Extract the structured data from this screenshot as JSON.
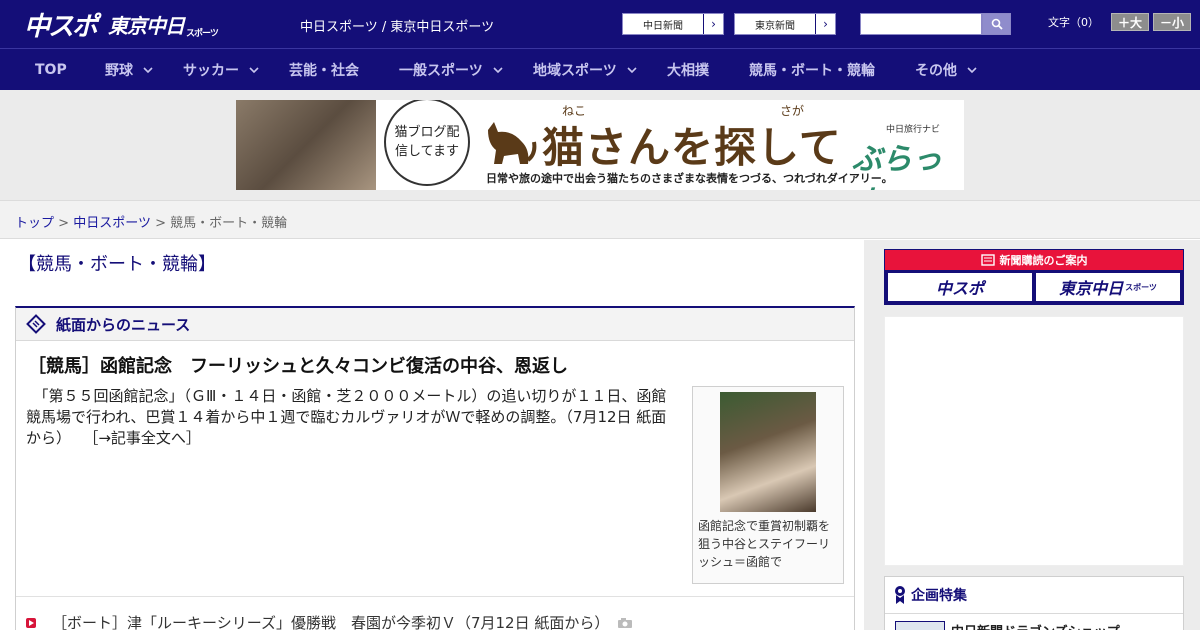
{
  "header": {
    "logo_main": "中スポ",
    "logo_tokyo": "東京中日",
    "logo_tokyo_small": "スポーツ",
    "site_title": "中日スポーツ / 東京中日スポーツ",
    "ext_links": [
      {
        "label": "中日新聞",
        "arrow": "›"
      },
      {
        "label": "東京新聞",
        "arrow": "›"
      }
    ],
    "search": {
      "value": "",
      "placeholder": ""
    },
    "font_size": {
      "label": "文字（0）",
      "bigger": "＋大",
      "smaller": "－小"
    }
  },
  "nav": [
    {
      "label": "TOP",
      "dropdown": false
    },
    {
      "label": "野球",
      "dropdown": true
    },
    {
      "label": "サッカー",
      "dropdown": true
    },
    {
      "label": "芸能・社会",
      "dropdown": false
    },
    {
      "label": "一般スポーツ",
      "dropdown": true
    },
    {
      "label": "地域スポーツ",
      "dropdown": true
    },
    {
      "label": "大相撲",
      "dropdown": false
    },
    {
      "label": "競馬・ボート・競輪",
      "dropdown": false
    },
    {
      "label": "その他",
      "dropdown": true
    }
  ],
  "banner": {
    "bubble": "猫ブログ配信してます",
    "title": "猫さんを探して",
    "ruby1": "ねこ",
    "ruby2": "さが",
    "subtitle": "日常や旅の途中で出会う猫たちのさまざまな表情をつづる、つれづれダイアリー。",
    "brand_small": "中日旅行ナビ",
    "brand": "ぶらっ人"
  },
  "breadcrumb": {
    "items": [
      "トップ",
      "中日スポーツ"
    ],
    "separator": ">",
    "current": "競馬・ボート・競輪"
  },
  "page": {
    "title": "【競馬・ボート・競輪】"
  },
  "news": {
    "heading": "紙面からのニュース",
    "article": {
      "title": "［競馬］函館記念　フーリッシュと久々コンビ復活の中谷、恩返し",
      "body": "　「第５５回函館記念」（ＧⅢ・１４日・函館・芝２０００メートル）の追い切りが１１日、函館競馬場で行われ、巴賞１４着から中１週で臨むカルヴァリオがＷで軽めの調整。（7月12日 紙面から）",
      "more": "［→記事全文へ］",
      "photo_caption": "函館記念で重賞初制覇を狙う中谷とステイフーリッシュ＝函館で"
    },
    "list": [
      {
        "text": "［ボート］津「ルーキーシリーズ」優勝戦　春園が今季初Ｖ（7月12日 紙面から）"
      }
    ]
  },
  "sidebar": {
    "subscribe_head": "新聞購読のご案内",
    "subscribe_logos": [
      "中スポ",
      "東京中日"
    ],
    "subscribe_logo_small": "スポーツ",
    "feature_heading": "企画特集",
    "feature_item": "中日新聞ドラゴンズショップ"
  }
}
